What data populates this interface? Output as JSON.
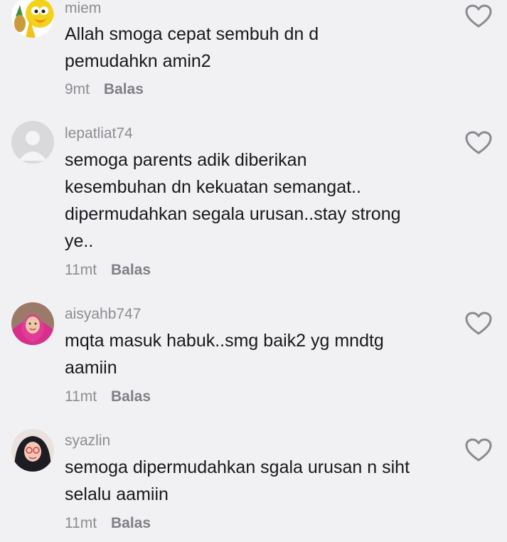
{
  "comments": [
    {
      "username": "miem",
      "text_lines": [
        "Allah smoga cepat sembuh dn d",
        "pemudahkn amin2"
      ],
      "time": "9mt",
      "reply_label": "Balas",
      "avatar_icon": "big-bird-icon"
    },
    {
      "username": "lepatliat74",
      "text_lines": [
        "semoga parents adik diberikan",
        "kesembuhan dn kekuatan semangat..",
        "dipermudahkan segala urusan..stay strong",
        "ye.."
      ],
      "time": "11mt",
      "reply_label": "Balas",
      "avatar_icon": "default-user-icon"
    },
    {
      "username": "aisyahb747",
      "text_lines": [
        "mqta masuk habuk..smg baik2 yg mndtg",
        "aamiin"
      ],
      "time": "11mt",
      "reply_label": "Balas",
      "avatar_icon": "user-photo-icon"
    },
    {
      "username": "syazlin",
      "text_lines": [
        "semoga dipermudahkan sgala urusan n siht",
        "selalu aamiin"
      ],
      "time": "11mt",
      "reply_label": "Balas",
      "avatar_icon": "user-photo-icon"
    }
  ],
  "colors": {
    "background": "#f1f1f3",
    "text": "#18181d",
    "muted": "#8c8c92",
    "heart": "#8a8a90"
  },
  "like_icon": "heart-outline-icon"
}
